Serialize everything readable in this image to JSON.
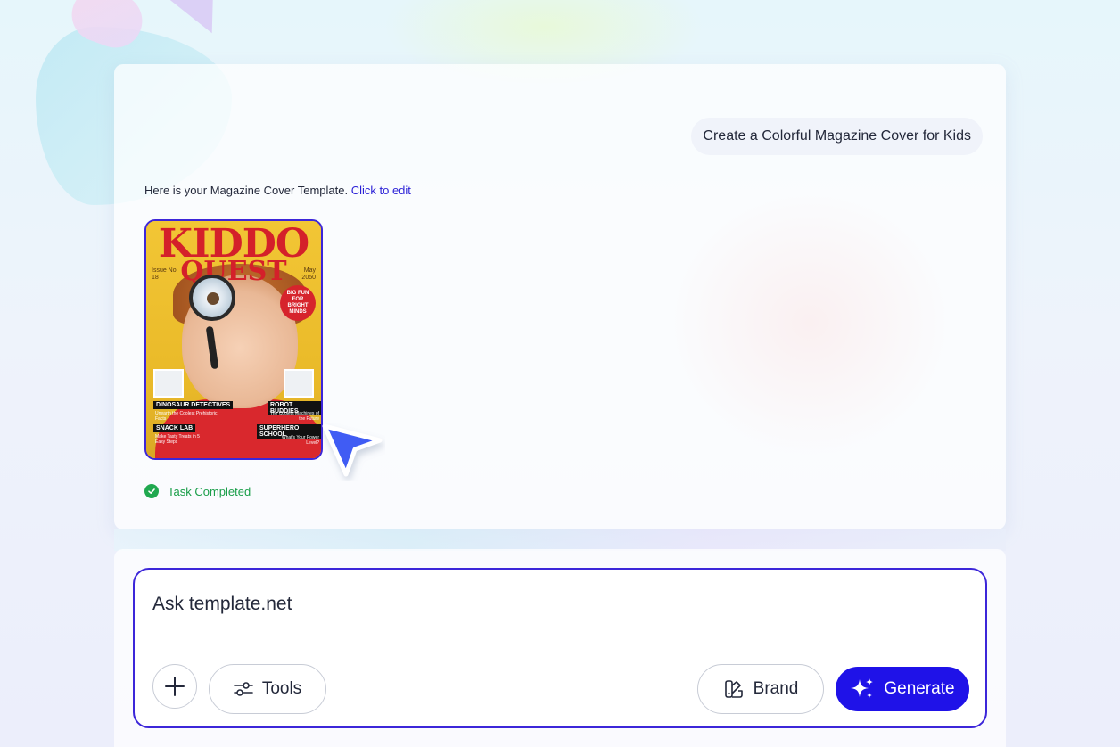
{
  "chat": {
    "user_message": "Create a Colorful Magazine Cover for Kids",
    "reply_text": "Here is your Magazine Cover Template.",
    "reply_link": "Click to edit",
    "status_text": "Task Completed"
  },
  "cover": {
    "title_line1": "KIDDO",
    "title_line2": "QUEST",
    "issue": "Issue No.\n18",
    "date": "May\n2050",
    "badge": "BIG FUN FOR BRIGHT MINDS",
    "story1_title": "DINOSAUR DETECTIVES",
    "story1_sub": "Unearth the Coolest Prehistoric Facts",
    "story2_title": "ROBOT BUDDIES",
    "story2_sub": "The Coolest Machines of the Future",
    "story3_title": "SNACK LAB",
    "story3_sub": "Make Tasty Treats in 5 Easy Steps",
    "story4_title": "SUPERHERO SCHOOL",
    "story4_sub": "What's Your Power Level?"
  },
  "composer": {
    "placeholder": "Ask template.net",
    "tools_label": "Tools",
    "brand_label": "Brand",
    "generate_label": "Generate"
  },
  "colors": {
    "accent": "#1f12e8",
    "border_accent": "#3c26d9",
    "success": "#20a84f",
    "link": "#2a1fd6"
  },
  "icons": {
    "plus": "plus-icon",
    "tools": "sliders-icon",
    "brand": "palette-icon",
    "generate": "sparkle-icon",
    "status": "check-circle-icon",
    "cursor": "cursor-arrow-icon"
  }
}
